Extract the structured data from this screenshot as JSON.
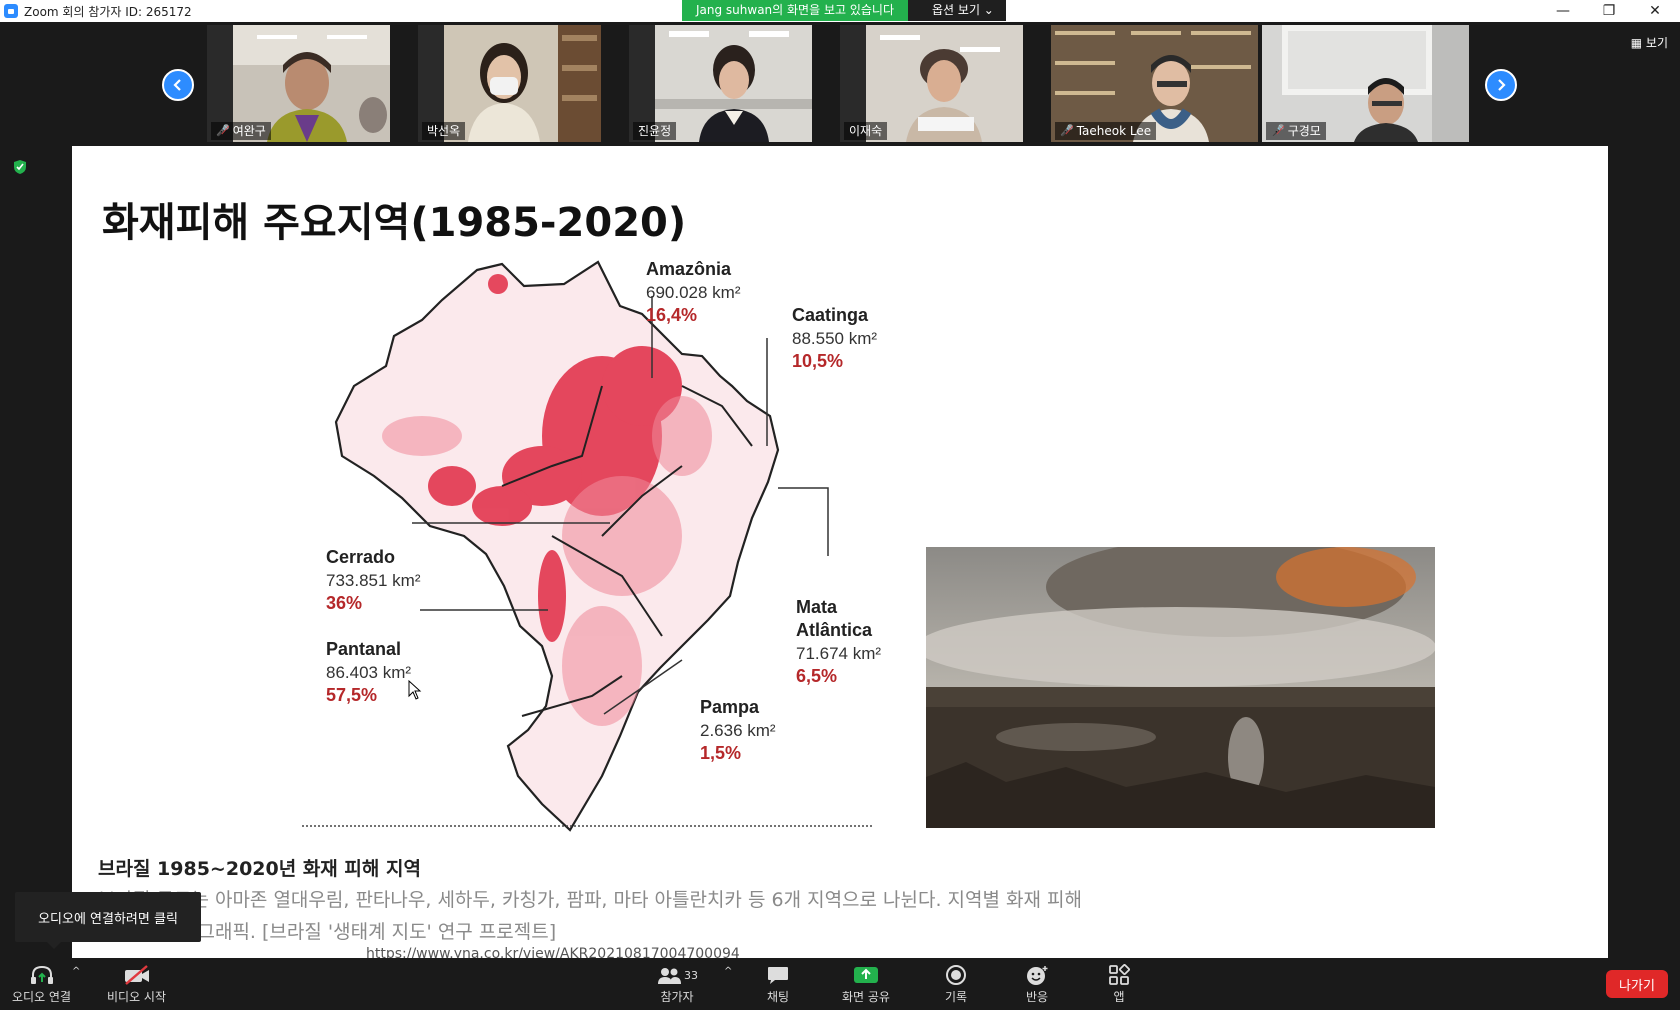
{
  "window": {
    "title": "Zoom 회의 참가자 ID: 265172",
    "minimize_glyph": "—",
    "restore_glyph": "❐",
    "close_glyph": "✕"
  },
  "share_banner": {
    "text": "Jang suhwan의 화면을 보고 있습니다",
    "options_label": "옵션 보기 ⌄"
  },
  "gallery": {
    "view_label": "보기",
    "participants": [
      {
        "name": "여완구",
        "muted": true
      },
      {
        "name": "박선옥",
        "muted": false
      },
      {
        "name": "진윤정",
        "muted": false
      },
      {
        "name": "이재숙",
        "muted": false
      },
      {
        "name": "Taeheok Lee",
        "muted": true
      },
      {
        "name": "구경모",
        "muted": true
      }
    ]
  },
  "slide": {
    "title": "화재피해 주요지역(1985-2020)",
    "regions": [
      {
        "name": "Amazônia",
        "area": "690.028 km²",
        "pct": "16,4%"
      },
      {
        "name": "Caatinga",
        "area": "88.550 km²",
        "pct": "10,5%"
      },
      {
        "name": "Cerrado",
        "area": "733.851 km²",
        "pct": "36%"
      },
      {
        "name": "Pantanal",
        "area": "86.403 km²",
        "pct": "57,5%"
      },
      {
        "name": "Mata Atlântica",
        "area": "71.674 km²",
        "pct": "6,5%"
      },
      {
        "name": "Pampa",
        "area": "2.636 km²",
        "pct": "1,5%"
      }
    ],
    "caption_head": "브라질 1985~2020년 화재 피해 지역",
    "caption_line1": "브라질 국토는 아마존 열대우림, 판타나우, 세하두, 카칭가, 팜파, 마타 아틀란치카 등 6개 지역으로 나뉜다. 지역별 화재 피해",
    "caption_line2": "를 보여주는 그래픽. [브라질 '생태계 지도' 연구 프로젝트]",
    "caption_url": "https://www.yna.co.kr/view/AKR20210817004700094"
  },
  "tooltip": "오디오에 연결하려면 클릭",
  "toolbar": {
    "audio": "오디오 연결",
    "video": "비디오 시작",
    "participants": "참가자",
    "participants_count": "33",
    "chat": "채팅",
    "share": "화면 공유",
    "record": "기록",
    "reactions": "반응",
    "apps": "앱",
    "leave": "나가기"
  },
  "colors": {
    "accent": "#2d8cff",
    "share_green": "#23b14d",
    "fire_red": "#e02b45",
    "leave_red": "#e02828",
    "pct_red": "#b5282a"
  }
}
